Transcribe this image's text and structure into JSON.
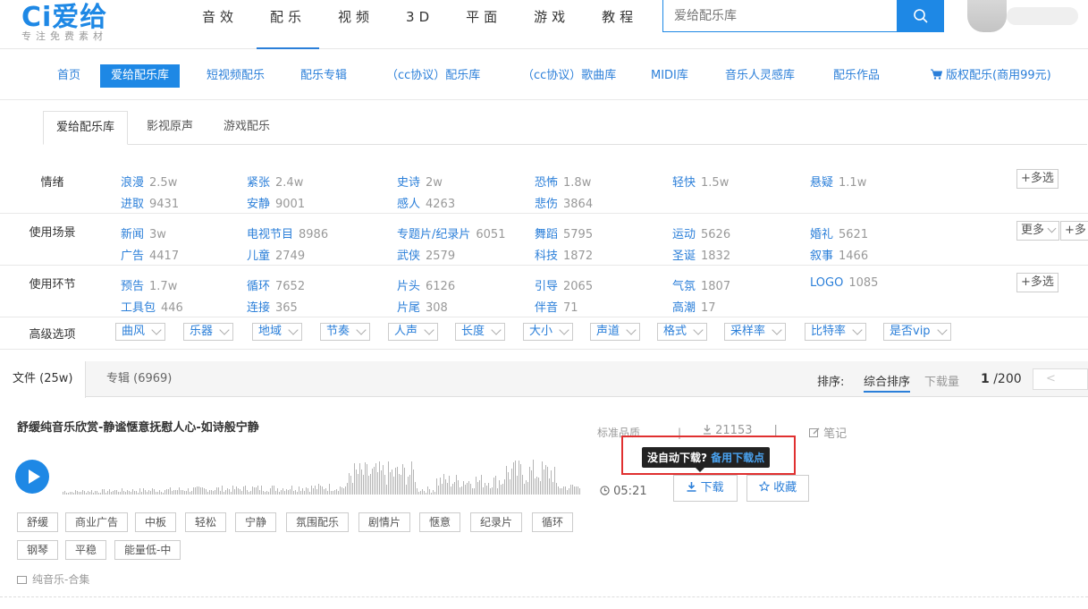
{
  "logo": {
    "mark": "Ci爱给",
    "slogan": "专注免费素材"
  },
  "main_nav": [
    "音效",
    "配乐",
    "视频",
    "3D",
    "平面",
    "游戏",
    "教程"
  ],
  "main_nav_active": "配乐",
  "search": {
    "placeholder": "爱给配乐库",
    "button_icon": "search-icon"
  },
  "sub_nav": [
    "首页",
    "爱给配乐库",
    "短视频配乐",
    "配乐专辑",
    "（cc协议）配乐库",
    "（cc协议）歌曲库",
    "MIDI库",
    "音乐人灵感库",
    "配乐作品",
    "版权配乐(商用99元)"
  ],
  "sub_nav_active": "爱给配乐库",
  "cart_icon": "cart-icon",
  "library_tabs": [
    "爱给配乐库",
    "影视原声",
    "游戏配乐"
  ],
  "filters": {
    "emotion": {
      "label": "情绪",
      "row1": [
        [
          "浪漫",
          "2.5w"
        ],
        [
          "紧张",
          "2.4w"
        ],
        [
          "史诗",
          "2w"
        ],
        [
          "恐怖",
          "1.8w"
        ],
        [
          "轻快",
          "1.5w"
        ],
        [
          "悬疑",
          "1.1w"
        ]
      ],
      "row2": [
        [
          "进取",
          "9431"
        ],
        [
          "安静",
          "9001"
        ],
        [
          "感人",
          "4263"
        ],
        [
          "悲伤",
          "3864"
        ]
      ],
      "multi": "+多选"
    },
    "scene": {
      "label": "使用场景",
      "row1": [
        [
          "新闻",
          "3w"
        ],
        [
          "电视节目",
          "8986"
        ],
        [
          "专题片/纪录片",
          "6051"
        ],
        [
          "舞蹈",
          "5795"
        ],
        [
          "运动",
          "5626"
        ],
        [
          "婚礼",
          "5621"
        ]
      ],
      "row2": [
        [
          "广告",
          "4417"
        ],
        [
          "儿童",
          "2749"
        ],
        [
          "武侠",
          "2579"
        ],
        [
          "科技",
          "1872"
        ],
        [
          "圣诞",
          "1832"
        ],
        [
          "叙事",
          "1466"
        ]
      ],
      "more": "更多",
      "multi": "+多"
    },
    "stage": {
      "label": "使用环节",
      "row1": [
        [
          "预告",
          "1.7w"
        ],
        [
          "循环",
          "7652"
        ],
        [
          "片头",
          "6126"
        ],
        [
          "引导",
          "2065"
        ],
        [
          "气氛",
          "1807"
        ],
        [
          "LOGO",
          "1085"
        ]
      ],
      "row2": [
        [
          "工具包",
          "446"
        ],
        [
          "连接",
          "365"
        ],
        [
          "片尾",
          "308"
        ],
        [
          "伴音",
          "71"
        ],
        [
          "高潮",
          "17"
        ]
      ],
      "multi": "+多选"
    },
    "advanced": {
      "label": "高级选项",
      "options": [
        "曲风",
        "乐器",
        "地域",
        "节奏",
        "人声",
        "长度",
        "大小",
        "声道",
        "格式",
        "采样率",
        "比特率",
        "是否vip"
      ]
    }
  },
  "results": {
    "tabs": [
      "文件 (25w)",
      "专辑 (6969)"
    ],
    "sort_label": "排序:",
    "sort_options": [
      "综合排序",
      "下载量"
    ],
    "page_current": "1",
    "page_total": "/200",
    "prev_icon": "chevron-left-icon"
  },
  "track": {
    "title": "舒缓纯音乐欣赏-静谧惬意抚慰人心-如诗般宁静",
    "quality": "标准品质",
    "sep": "|",
    "downloads": "21153",
    "note": "笔记",
    "duration": "05:21",
    "download_label": "下载",
    "favorite_label": "收藏",
    "tooltip_main": "没自动下载?",
    "tooltip_link": "备用下载点",
    "tags": [
      "舒缓",
      "商业广告",
      "中板",
      "轻松",
      "宁静",
      "氛围配乐",
      "剧情片",
      "惬意",
      "纪录片",
      "循环",
      "钢琴",
      "平稳",
      "能量低-中"
    ],
    "album": "纯音乐-合集"
  }
}
